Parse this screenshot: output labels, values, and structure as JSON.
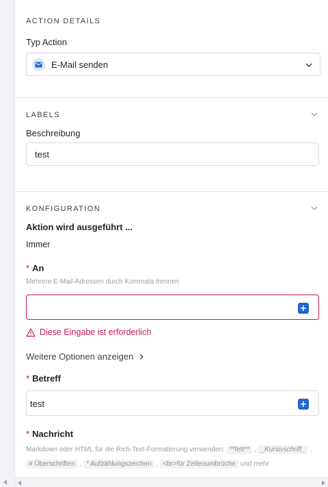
{
  "action_details": {
    "title": "ACTION DETAILS",
    "type_label": "Typ Action",
    "type_value": "E-Mail senden"
  },
  "labels": {
    "title": "LABELS",
    "description_label": "Beschreibung",
    "description_value": "test"
  },
  "configuration": {
    "title": "KONFIGURATION",
    "executed_label": "Aktion wird ausgeführt ...",
    "executed_value": "Immer",
    "required_marker": "*",
    "to_label": "An",
    "to_hint": "Mehrere E-Mail-Adressen durch Kommata trennen",
    "to_value": "",
    "to_error": "Diese Eingabe ist erforderlich",
    "more_options": "Weitere Optionen anzeigen",
    "subject_label": "Betreff",
    "subject_value": "test",
    "message_label": "Nachricht",
    "message_hint": {
      "intro": "Markdown oder HTML für die Rich-Text-Formatierung verwenden: ",
      "bold_code": "**fett**",
      "sep1": " , ",
      "italic_code": "_Kursivschrift_",
      "sep2": " , ",
      "heading_code": "# Überschriften",
      "sep3": " , ",
      "list_code": "* Aufzählungszeichen",
      "sep4": " , ",
      "br_code": "<br>für Zeilenumbrüche",
      "outro": " und mehr"
    }
  },
  "colors": {
    "error": "#c9184a",
    "accent": "#1f66d6"
  }
}
